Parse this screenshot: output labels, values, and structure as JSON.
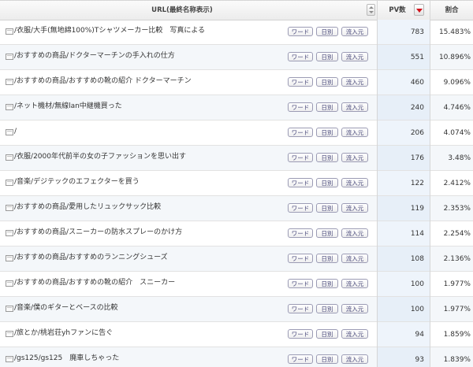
{
  "header": {
    "url_label": "URL(最終名称表示)",
    "pv_label": "PV数",
    "ratio_label": "割合"
  },
  "buttons": {
    "word": "ワード",
    "daily": "日別",
    "source": "流入元"
  },
  "rows": [
    {
      "url": "/衣服/大手(無地綿100%)Tシャツメーカー比較　写真による",
      "pv": "783",
      "ratio": "15.483%"
    },
    {
      "url": "/おすすめの商品/ドクターマーチンの手入れの仕方",
      "pv": "551",
      "ratio": "10.896%"
    },
    {
      "url": "/おすすめの商品/おすすめの靴の紹介 ドクターマーチン",
      "pv": "460",
      "ratio": "9.096%"
    },
    {
      "url": "/ネット機材/無線lan中継機買った",
      "pv": "240",
      "ratio": "4.746%"
    },
    {
      "url": "/",
      "pv": "206",
      "ratio": "4.074%"
    },
    {
      "url": "/衣服/2000年代前半の女の子ファッションを思い出す",
      "pv": "176",
      "ratio": "3.48%"
    },
    {
      "url": "/音楽/デジテックのエフェクターを買う",
      "pv": "122",
      "ratio": "2.412%"
    },
    {
      "url": "/おすすめの商品/愛用したリュックサック比較",
      "pv": "119",
      "ratio": "2.353%"
    },
    {
      "url": "/おすすめの商品/スニーカーの防水スプレーのかけ方",
      "pv": "114",
      "ratio": "2.254%"
    },
    {
      "url": "/おすすめの商品/おすすめのランニングシューズ",
      "pv": "108",
      "ratio": "2.136%"
    },
    {
      "url": "/おすすめの商品/おすすめの靴の紹介　スニーカー",
      "pv": "100",
      "ratio": "1.977%"
    },
    {
      "url": "/音楽/僕のギターとベースの比較",
      "pv": "100",
      "ratio": "1.977%"
    },
    {
      "url": "/旅とか/桃岩荘yhファンに告ぐ",
      "pv": "94",
      "ratio": "1.859%"
    },
    {
      "url": "/gs125/gs125　廃車しちゃった",
      "pv": "93",
      "ratio": "1.839%"
    }
  ]
}
